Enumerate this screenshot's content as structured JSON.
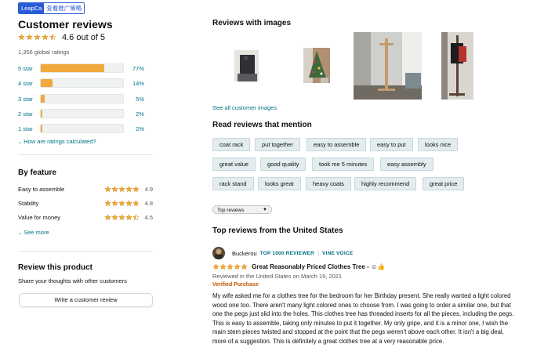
{
  "extension": {
    "brand": "LeapCa",
    "label": "查看推广策略"
  },
  "summary": {
    "title": "Customer reviews",
    "rating_text": "4.6 out of 5",
    "rating_value": 4.6,
    "global_ratings": "1,356 global ratings",
    "histogram": [
      {
        "label": "5 star",
        "percent_text": "77%",
        "percent": 77
      },
      {
        "label": "4 star",
        "percent_text": "14%",
        "percent": 14
      },
      {
        "label": "3 star",
        "percent_text": "5%",
        "percent": 5
      },
      {
        "label": "2 star",
        "percent_text": "2%",
        "percent": 2
      },
      {
        "label": "1 star",
        "percent_text": "2%",
        "percent": 2
      }
    ],
    "how_calculated": "How are ratings calculated?"
  },
  "by_feature": {
    "title": "By feature",
    "items": [
      {
        "name": "Easy to assemble",
        "value": "4.9",
        "rating": 4.9
      },
      {
        "name": "Stability",
        "value": "4.8",
        "rating": 4.8
      },
      {
        "name": "Value for money",
        "value": "4.5",
        "rating": 4.5
      }
    ],
    "see_more": "See more"
  },
  "review_product": {
    "title": "Review this product",
    "subtitle": "Share your thoughts with other customers",
    "button": "Write a customer review"
  },
  "images_section": {
    "title": "Reviews with images",
    "see_all": "See all customer images"
  },
  "mentions": {
    "title": "Read reviews that mention",
    "chips": [
      [
        "coat rack",
        "put together",
        "easy to assemble",
        "easy to put",
        "looks nice"
      ],
      [
        "great value",
        "good quality",
        "took me 5 minutes",
        "easy assembly"
      ],
      [
        "rack stand",
        "looks great",
        "heavy coats",
        "highly recommend",
        "great price"
      ]
    ]
  },
  "sort": {
    "selected": "Top reviews"
  },
  "top_reviews": {
    "title": "Top reviews from the United States",
    "review": {
      "author": "Buckerou",
      "badge1": "TOP 1000 REVIEWER",
      "badge2": "VINE VOICE",
      "rating": 5,
      "headline": "Great Reasonably Priced Clothes Tree - ☺👍",
      "date": "Reviewed in the United States on March 19, 2021",
      "verified": "Verified Purchase",
      "body": "My wife asked me for a clothes tree for the bedroom for her Birthday present. She really wanted a light colored wood one too. There aren't many light colored ones to choose from. I was going to order a similar one, but that one the pegs just slid into the holes. This clothes tree has threaded inserts for all the pieces, including the pegs. This is easy to assemble, taking only minutes to put it together. My only gripe, and it is a minor one, I wish the main stem pieces twisted and stopped at the point that the pegs weren't above each other. It isn't a big deal, more of a suggestion. This is definitely a great clothes tree at a very reasonable price."
    }
  },
  "colors": {
    "star": "#f0a93a",
    "link": "#007185",
    "verified": "#c45500",
    "chip_bg": "#e3ecef"
  }
}
